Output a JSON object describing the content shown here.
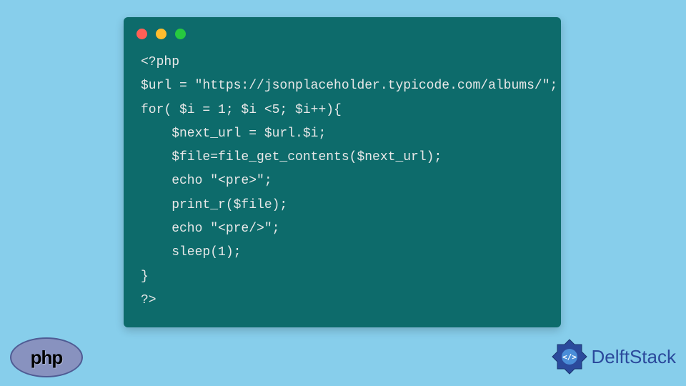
{
  "code": {
    "lines": [
      "<?php",
      "$url = \"https://jsonplaceholder.typicode.com/albums/\";",
      "for( $i = 1; $i <5; $i++){",
      "    $next_url = $url.$i;",
      "    $file=file_get_contents($next_url);",
      "    echo \"<pre>\";",
      "    print_r($file);",
      "    echo \"<pre/>\";",
      "    sleep(1);",
      "}",
      "?>"
    ]
  },
  "logos": {
    "php": "php",
    "delft": "DelftStack"
  },
  "colors": {
    "background": "#87ceeb",
    "codeWindow": "#0d6b6b",
    "codeText": "#e8e8e8",
    "phpEllipse": "#8892bf",
    "delftBlue": "#2b4a9c"
  }
}
